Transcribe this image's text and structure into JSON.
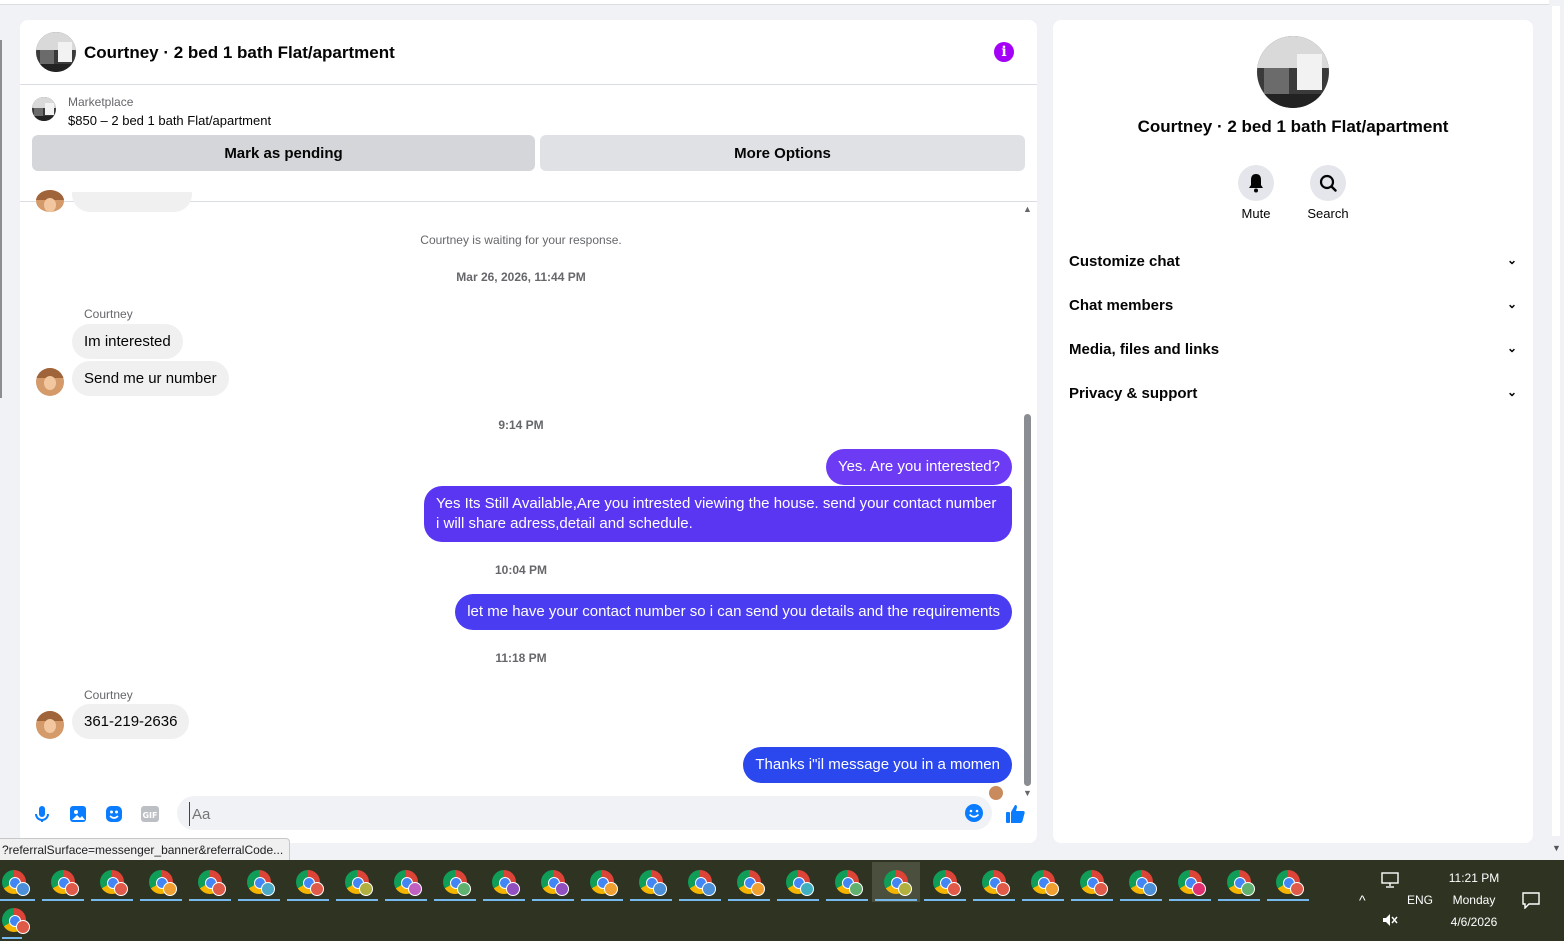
{
  "chat": {
    "title": "Courtney · 2 bed 1 bath Flat/apartment",
    "marketplace_label": "Marketplace",
    "listing": "$850 – 2 bed 1 bath Flat/apartment",
    "mark_pending": "Mark as pending",
    "more_options": "More Options",
    "waiting_notice": "Courtney is waiting for your response.",
    "timestamps": [
      "Mar 26, 2026, 11:44 PM",
      "9:14 PM",
      "10:04 PM",
      "11:18 PM"
    ],
    "sender_name": "Courtney",
    "incoming": [
      "Im interested",
      "Send me ur number",
      "361-219-2636"
    ],
    "outgoing": [
      "Yes. Are you interested?",
      "Yes Its Still Available,Are you intrested viewing the house. send your contact number i will share adress,detail and schedule.",
      "let me have your contact number so i can send you details and the requirements",
      "Thanks i\"il message you in a momen"
    ],
    "input_placeholder": "Aa"
  },
  "panel": {
    "title": "Courtney · 2 bed 1 bath Flat/apartment",
    "mute_label": "Mute",
    "search_label": "Search",
    "sections": [
      "Customize chat",
      "Chat members",
      "Media, files and links",
      "Privacy & support"
    ]
  },
  "status_url": "?referralSurface=messenger_banner&referralCode...",
  "taskbar": {
    "time": "11:21 PM",
    "day": "Monday",
    "date": "4/6/2026",
    "lang": "ENG",
    "badge_colors": [
      "#4a8fd8",
      "#e05a4a",
      "#e05a4a",
      "#f0a030",
      "#e05a4a",
      "#4aa8c8",
      "#e05a4a",
      "#b0b040",
      "#c060c0",
      "#60b070",
      "#9050c0",
      "#9050c0",
      "#f0a030",
      "#4a8fd8",
      "#4a8fd8",
      "#f0a030",
      "#40b0c0",
      "#60b070",
      "#b0b040",
      "#e05a4a",
      "#e05a4a",
      "#f0a030",
      "#e05a4a",
      "#4a8fd8",
      "#e03070",
      "#60b070",
      "#e05a4a"
    ]
  },
  "colors": {
    "accent": "#a400f7",
    "out_bubble_1": "#6e3bf5",
    "out_bubble_2": "#5a36f3",
    "out_bubble_3": "#4a3cf1",
    "out_bubble_4": "#2b48ef",
    "icon_blue": "#0a7cff"
  }
}
